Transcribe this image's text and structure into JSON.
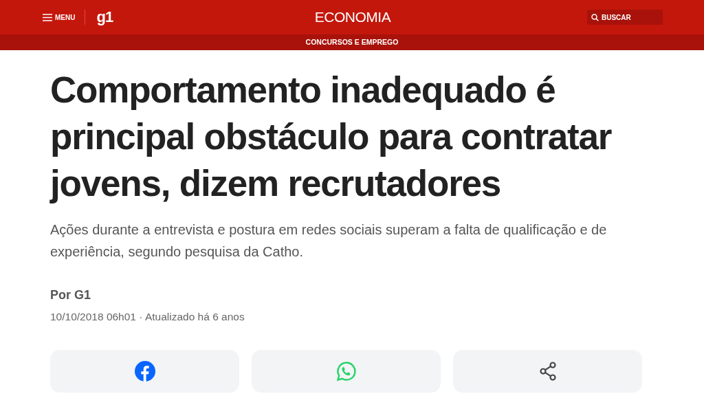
{
  "header": {
    "menu_label": "MENU",
    "logo": "g1",
    "section": "ECONOMIA",
    "search_label": "BUSCAR"
  },
  "subnav": {
    "label": "CONCURSOS E EMPREGO"
  },
  "article": {
    "headline": "Comportamento inadequado é principal obstáculo para contratar jovens, dizem recrutadores",
    "subtitle": "Ações durante a entrevista e postura em redes sociais superam a falta de qualificação e de experiência, segundo pesquisa da Catho.",
    "byline": "Por G1",
    "published": "10/10/2018 06h01",
    "separator": "·",
    "updated": "Atualizado há 6 anos"
  },
  "share_buttons": [
    {
      "kind": "facebook"
    },
    {
      "kind": "whatsapp"
    },
    {
      "kind": "share"
    }
  ]
}
